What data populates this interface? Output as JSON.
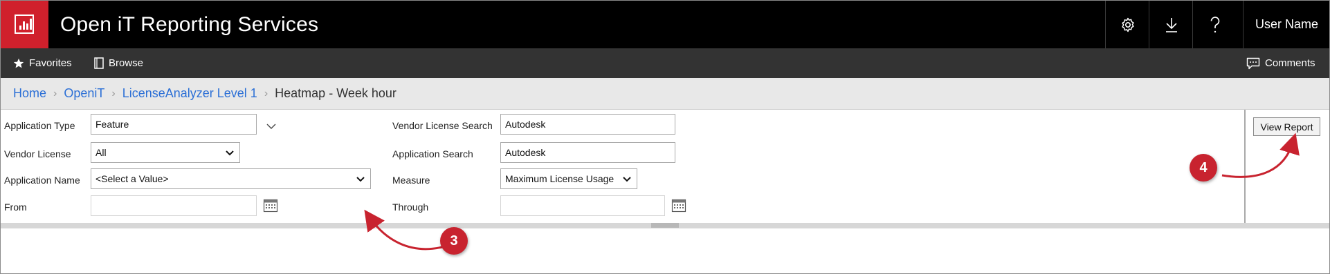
{
  "header": {
    "title": "Open iT Reporting Services",
    "user_name": "User Name"
  },
  "nav": {
    "favorites": "Favorites",
    "browse": "Browse",
    "comments": "Comments"
  },
  "breadcrumb": {
    "items": [
      "Home",
      "OpeniT",
      "LicenseAnalyzer Level 1"
    ],
    "current": "Heatmap - Week hour"
  },
  "params": {
    "application_type": {
      "label": "Application Type",
      "value": "Feature"
    },
    "vendor_license": {
      "label": "Vendor License",
      "value": "All"
    },
    "application_name": {
      "label": "Application Name",
      "value": "<Select a Value>"
    },
    "from": {
      "label": "From",
      "value": ""
    },
    "vendor_license_search": {
      "label": "Vendor License Search",
      "value": "Autodesk"
    },
    "application_search": {
      "label": "Application Search",
      "value": "Autodesk"
    },
    "measure": {
      "label": "Measure",
      "value": "Maximum License Usage"
    },
    "through": {
      "label": "Through",
      "value": ""
    }
  },
  "actions": {
    "view_report": "View Report"
  },
  "annotations": [
    "3",
    "4"
  ],
  "colors": {
    "brand_red": "#d0202c",
    "header_bg": "#000000",
    "nav_bg": "#333333",
    "link_blue": "#2b6fd6",
    "callout_red": "#c8232f"
  }
}
